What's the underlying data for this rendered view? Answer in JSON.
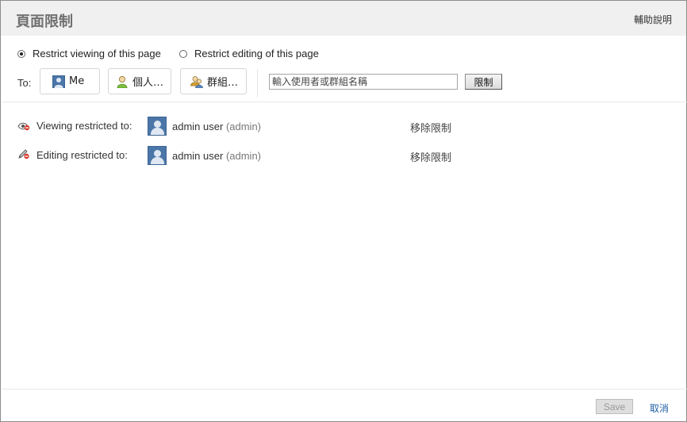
{
  "dialog": {
    "title": "頁面限制",
    "help_label": "輔助說明"
  },
  "mode": {
    "options": [
      {
        "label": "Restrict viewing of this page",
        "checked": true
      },
      {
        "label": "Restrict editing of this page",
        "checked": false
      }
    ]
  },
  "to": {
    "label": "To:",
    "chips": [
      {
        "label": "Me",
        "icon": "user-avatar-icon"
      },
      {
        "label": "個人…",
        "icon": "person-icon"
      },
      {
        "label": "群組…",
        "icon": "group-icon"
      }
    ],
    "input_placeholder": "輸入使用者或群組名稱",
    "restrict_label": "限制"
  },
  "restrictions": [
    {
      "kind": "view",
      "icon": "eye-restricted-icon",
      "label": "Viewing restricted to:",
      "user_name": "admin user",
      "user_id": "(admin)",
      "remove_label": "移除限制"
    },
    {
      "kind": "edit",
      "icon": "pencil-restricted-icon",
      "label": "Editing restricted to:",
      "user_name": "admin user",
      "user_id": "(admin)",
      "remove_label": "移除限制"
    }
  ],
  "footer": {
    "save_label": "Save",
    "cancel_label": "取消"
  },
  "colors": {
    "header_bg": "#f0f0f0",
    "link_blue": "#1f5fa6",
    "avatar_blue": "#4b76a8"
  }
}
